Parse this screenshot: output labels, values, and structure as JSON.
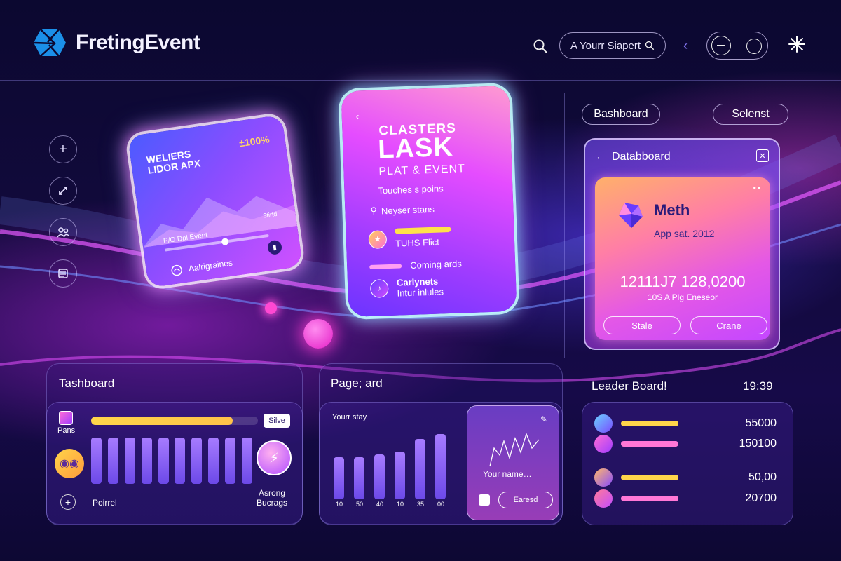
{
  "app": {
    "logo_text": "FretingEvent"
  },
  "header": {
    "search_label": "A Yourr Siapert",
    "colors": {
      "accent": "#8c7dff"
    }
  },
  "rail": {
    "icons": [
      "plus-icon",
      "link-icon",
      "users-icon",
      "list-icon"
    ]
  },
  "card1": {
    "title_line1": "WELIERS",
    "title_line2": "LIDOR APX",
    "percent": "±100%",
    "slider_label": "P/O Dai Event",
    "slider_value_label": "3tirtd",
    "slider_progress": 0.58,
    "footer_label": "Aalrigraines"
  },
  "card2": {
    "title_small": "CLASTERS",
    "title_big": "LASK",
    "subtitle": "PLAT & EVENT",
    "line1": "Touches s poins",
    "line2": "Neyser stans",
    "item1_label": "TUHS Flict",
    "item2_label": "Coming ards",
    "item3_title": "Carlynets",
    "item3_sub": "Intur inlules"
  },
  "right_panel": {
    "chip_left": "Bashboard",
    "chip_right": "Selenst",
    "card_title": "Databboard",
    "name": "Meth",
    "sub": "App sat. 2012",
    "big_number": "12111J7 128,0200",
    "small_text": "10S A Plg Eneseor",
    "btn_left": "Stale",
    "btn_right": "Crane"
  },
  "tashboard": {
    "title": "Tashboard",
    "icon_label": "Pans",
    "tag": "Silve",
    "bottom_left": "Poirrel",
    "bottom_right_1": "Asrong",
    "bottom_right_2": "Bucrags",
    "progress": 0.85,
    "bars": [
      0.72,
      0.72,
      0.72,
      0.72,
      0.72,
      0.72,
      0.72,
      0.72,
      0.72,
      0.72
    ]
  },
  "pageard": {
    "title": "Page; ard",
    "chart_label": "Yourr stay",
    "x_labels": [
      "10",
      "50",
      "40",
      "10",
      "35",
      "00"
    ],
    "bars": [
      0.55,
      0.55,
      0.58,
      0.62,
      0.78,
      0.85
    ],
    "overlay_text": "Your name…",
    "overlay_btn": "Earesd"
  },
  "leaderboard": {
    "title": "Leader Board!",
    "time": "19:39",
    "rows": [
      {
        "value": "55000",
        "bar_color": "#ffd54a"
      },
      {
        "value": "150100",
        "bar_color": "#ff77d6"
      },
      {
        "value": "50,00",
        "bar_color": "#ffd54a"
      },
      {
        "value": "20700",
        "bar_color": "#ff77d6"
      }
    ]
  }
}
